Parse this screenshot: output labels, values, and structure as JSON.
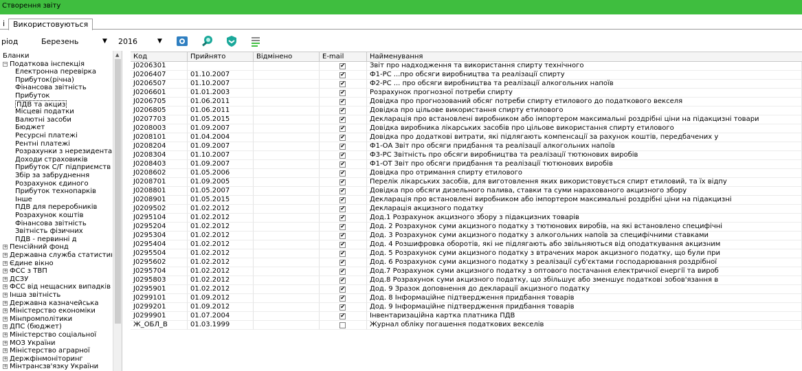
{
  "window": {
    "title": "Створення звіту"
  },
  "tabs": [
    {
      "label": "і"
    },
    {
      "label": "Використовуються"
    }
  ],
  "toolbar": {
    "period_label": "ріод",
    "month_value": "Березень",
    "year_value": "2016"
  },
  "tree": [
    {
      "label": "Бланки",
      "level": 0,
      "expander": ""
    },
    {
      "label": "Податкова інспекція",
      "level": 1,
      "expander": "minus"
    },
    {
      "label": "Електронна перевірка",
      "level": 2
    },
    {
      "label": "Прибуток(річна)",
      "level": 2
    },
    {
      "label": "Фінансова звітність",
      "level": 2
    },
    {
      "label": "Прибуток",
      "level": 2
    },
    {
      "label": "ПДВ та акциз",
      "level": 2,
      "selected": true
    },
    {
      "label": "Місцеві податки",
      "level": 2
    },
    {
      "label": "Валютні засоби",
      "level": 2
    },
    {
      "label": "Бюджет",
      "level": 2
    },
    {
      "label": "Ресурсні платежі",
      "level": 2
    },
    {
      "label": "Рентні платежі",
      "level": 2
    },
    {
      "label": "Розрахунки з нерезидентами",
      "level": 2
    },
    {
      "label": "Доходи страховиків",
      "level": 2
    },
    {
      "label": "Прибуток С/Г підприємств",
      "level": 2
    },
    {
      "label": "Збір за забруднення",
      "level": 2
    },
    {
      "label": "Розрахунок єдиного",
      "level": 2
    },
    {
      "label": "Прибуток технопарків",
      "level": 2
    },
    {
      "label": "Інше",
      "level": 2
    },
    {
      "label": "ПДВ для переробників",
      "level": 2
    },
    {
      "label": "Розрахунок коштів",
      "level": 2
    },
    {
      "label": "Фінансова звітність",
      "level": 2
    },
    {
      "label": "Звітність фізичних",
      "level": 2
    },
    {
      "label": "ПДВ - первинні д",
      "level": 2
    },
    {
      "label": "Пенсійний фонд",
      "level": 1,
      "expander": "plus"
    },
    {
      "label": "Державна служба статистики",
      "level": 1,
      "expander": "plus"
    },
    {
      "label": "Єдине вікно",
      "level": 1,
      "expander": "plus"
    },
    {
      "label": "ФСС з ТВП",
      "level": 1,
      "expander": "plus"
    },
    {
      "label": "ДСЗУ",
      "level": 1,
      "expander": "plus"
    },
    {
      "label": "ФСС від нещасних випадків",
      "level": 1,
      "expander": "plus"
    },
    {
      "label": "Інша звітність",
      "level": 1,
      "expander": "plus"
    },
    {
      "label": "Державна казначейська",
      "level": 1,
      "expander": "plus"
    },
    {
      "label": "Міністерство економіки",
      "level": 1,
      "expander": "plus"
    },
    {
      "label": "Мінпромполітики",
      "level": 1,
      "expander": "plus"
    },
    {
      "label": "ДПС (бюджет)",
      "level": 1,
      "expander": "plus"
    },
    {
      "label": "Міністерство соціальної",
      "level": 1,
      "expander": "plus"
    },
    {
      "label": "МОЗ України",
      "level": 1,
      "expander": "plus"
    },
    {
      "label": "Міністерство аграрної",
      "level": 1,
      "expander": "plus"
    },
    {
      "label": "Держфінмоніторинг",
      "level": 1,
      "expander": "plus"
    },
    {
      "label": "Мінтрансзв'язку України",
      "level": 1,
      "expander": "plus"
    }
  ],
  "table": {
    "columns": [
      "Код",
      "Прийнято",
      "Відмінено",
      "E-mail",
      "Найменування"
    ],
    "rows": [
      [
        "J0206301",
        "",
        "",
        true,
        "Звіт про надходження та використання спирту технічного"
      ],
      [
        "J0206407",
        "01.10.2007",
        "",
        true,
        "Ф1-РС  ...про обсяги виробництва та реалізації спирту"
      ],
      [
        "J0206507",
        "01.10.2007",
        "",
        true,
        "Ф2-РС  ... про обсяги виробництва та реалізації алкогольних напоїв"
      ],
      [
        "J0206601",
        "01.01.2003",
        "",
        true,
        "Розрахунок прогнозної потреби спирту"
      ],
      [
        "J0206705",
        "01.06.2011",
        "",
        true,
        "Довідка про прогнозований обсяг потреби спирту етилового до податкового векселя"
      ],
      [
        "J0206805",
        "01.06.2011",
        "",
        true,
        "Довідка про цільове використання спирту етилового"
      ],
      [
        "J0207703",
        "01.05.2015",
        "",
        true,
        "Декларація про встановлені виробником або імпортером максимальні роздрібні ціни на підакцизні товари"
      ],
      [
        "J0208003",
        "01.09.2007",
        "",
        true,
        "Довідка виробника лікарських засобів про цільове використання спирту етилового"
      ],
      [
        "J0208101",
        "01.04.2004",
        "",
        true,
        "Довідка про додаткові витрати, які підлягають компенсації за рахунок коштів, передбачених у"
      ],
      [
        "J0208204",
        "01.09.2007",
        "",
        true,
        "Ф1-ОА Звіт про обсяги придбання та реалізації алкогольних напоїв"
      ],
      [
        "J0208304",
        "01.10.2007",
        "",
        true,
        "Ф3-РС  Звітність про обсяги виробництва та реалізації тютюнових виробів"
      ],
      [
        "J0208403",
        "01.09.2007",
        "",
        true,
        "Ф1-ОТ Звіт про обсяги придбання та реалізації тютюнових виробів"
      ],
      [
        "J0208602",
        "01.05.2006",
        "",
        true,
        "Довідка про отримання спирту етилового"
      ],
      [
        "J0208701",
        "01.09.2005",
        "",
        true,
        "Перелік лікарських засобів, для виготовлення яких використовується спирт етиловий, та їх відпу"
      ],
      [
        "J0208801",
        "01.05.2007",
        "",
        true,
        "Довідка про обсяги дизельного палива, ставки та суми нарахованого акцизного збору"
      ],
      [
        "J0208901",
        "01.05.2015",
        "",
        true,
        "Декларація про встановлені виробником або імпортером максимальні роздрібні ціни на підакцизні"
      ],
      [
        "J0209502",
        "01.02.2012",
        "",
        true,
        " Декларація акцизного податку"
      ],
      [
        "J0295104",
        "01.02.2012",
        "",
        true,
        "Дод.1 Розрахунок акцизного збору з підакцизних товарів"
      ],
      [
        "J0295204",
        "01.02.2012",
        "",
        true,
        "Дод. 2 Розрахунок суми акцизного податку з тютюнових виробів, на які встановлено специфічні"
      ],
      [
        "J0295304",
        "01.02.2012",
        "",
        true,
        "Дод. 3 Розрахунок суми акцизного податку з алкогольних напоїв за специфічними ставками"
      ],
      [
        "J0295404",
        "01.02.2012",
        "",
        true,
        "Дод. 4 Розшифровка оборотів, які не підлягають або звільняються від оподаткування акцизним"
      ],
      [
        "J0295504",
        "01.02.2012",
        "",
        true,
        "Дод. 5 Розрахунок суми акцизного податку з втрачених марок акцизного податку, що були при"
      ],
      [
        "J0295602",
        "01.02.2012",
        "",
        true,
        " Дод. 6 Розрахунок суми акцизного податку з реалізації суб'єктами господарювання роздрібної"
      ],
      [
        "J0295704",
        "01.02.2012",
        "",
        true,
        " Дод.7 Розрахунок суми акцизного податку з оптового постачання електричної енергії та вироб"
      ],
      [
        "J0295803",
        "01.02.2012",
        "",
        true,
        " Дод.8 Розрахунок суми акцизного податку, що збільшує або зменшує податкові зобов'язання в"
      ],
      [
        "J0295901",
        "01.02.2012",
        "",
        true,
        "Дод. 9 Зразок доповнення до декларації акцизного податку"
      ],
      [
        "J0299101",
        "01.09.2012",
        "",
        true,
        "Дод. 8 Інформаційне підтвердження придбання товарів"
      ],
      [
        "J0299201",
        "01.09.2012",
        "",
        true,
        "Дод. 9 Інформаційне підтвердження придбання товарів"
      ],
      [
        "J0299901",
        "01.07.2004",
        "",
        true,
        "Інвентаризаційна картка платника  ПДВ"
      ],
      [
        "Ж_ОБЛ_В",
        "01.03.1999",
        "",
        false,
        "Журнал обліку погашення податкових векселів"
      ]
    ]
  },
  "colors": {
    "titlebar": "#3fbe3f",
    "grid_header": "#f4f4f4",
    "border": "#c8c8c8"
  },
  "icons": [
    "settings-gear-icon",
    "search-icon",
    "shield-icon",
    "document-list-icon"
  ]
}
